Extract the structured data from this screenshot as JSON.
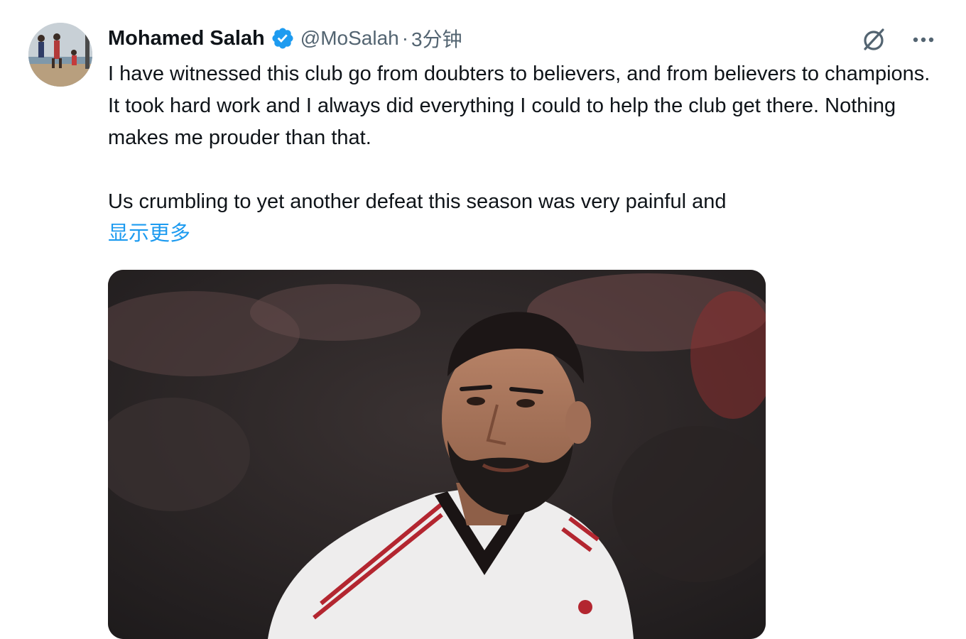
{
  "tweet": {
    "author": {
      "name": "Mohamed Salah",
      "handle": "@MoSalah",
      "separator": "·",
      "time": "3分钟",
      "verified": true
    },
    "text_paragraphs": [
      "I have witnessed this club go from doubters to believers, and from believers to champions. It took hard work and I always did everything I could to help the club get there. Nothing makes me prouder than that.",
      "Us crumbling to yet another defeat this season was very painful and"
    ],
    "show_more_label": "显示更多",
    "media": {
      "type": "photo",
      "subject": "footballer-portrait"
    }
  },
  "icons": {
    "verified": "verified-badge-icon",
    "grok": "grok-icon",
    "more": "more-options-icon"
  },
  "colors": {
    "verified_blue": "#1d9bf0",
    "link_blue": "#1d9bf0",
    "text_primary": "#0f1419",
    "text_secondary": "#536471"
  }
}
